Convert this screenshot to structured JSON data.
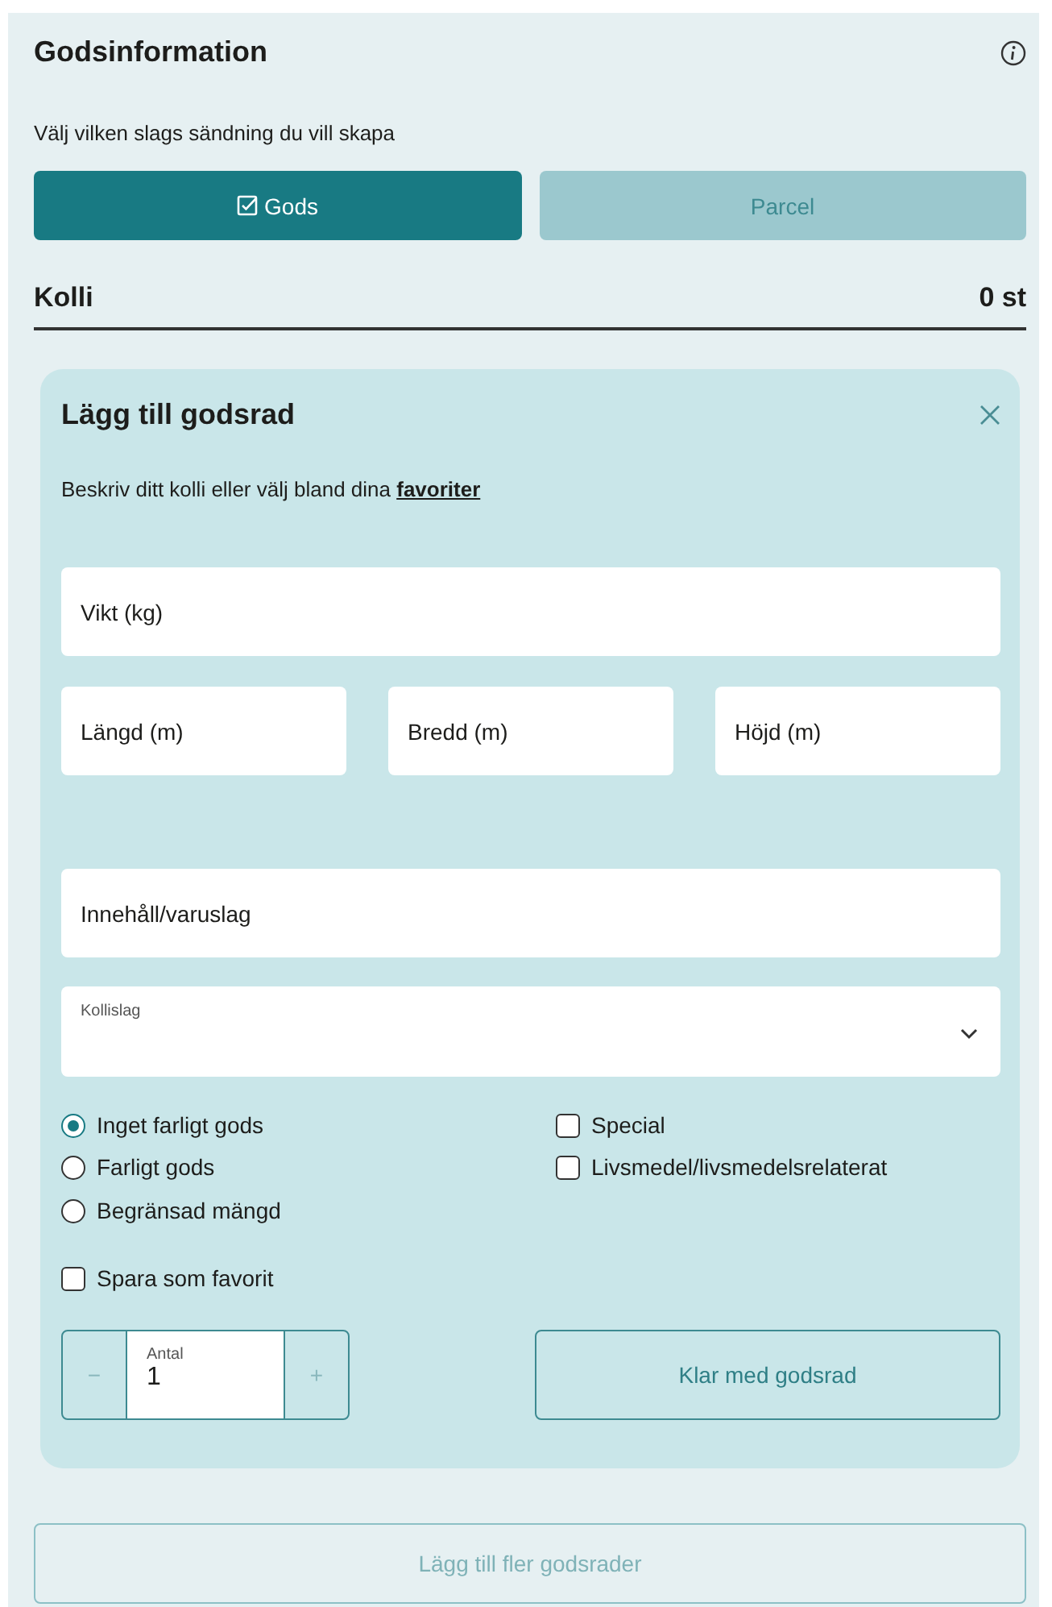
{
  "header": {
    "title": "Godsinformation",
    "subtitle": "Välj vilken slags sändning du vill skapa"
  },
  "tabs": [
    {
      "label": "Gods",
      "selected": true
    },
    {
      "label": "Parcel",
      "selected": false
    }
  ],
  "summary": {
    "label": "Kolli",
    "count": "0 st"
  },
  "card": {
    "title": "Lägg till godsrad",
    "description": "Beskriv ditt kolli eller välj bland dina",
    "link": "favoriter",
    "weight_field": {
      "placeholder": "Vikt (kg)"
    },
    "dimension_fields": [
      {
        "placeholder": "Längd (m)"
      },
      {
        "placeholder": "Bredd (m)"
      },
      {
        "placeholder": "Höjd (m)"
      }
    ],
    "content_field": {
      "placeholder": "Innehåll/varuslag"
    },
    "package_select": {
      "label": "Kollislag"
    },
    "hazard_options": [
      {
        "label": "Inget farligt gods",
        "selected": true
      },
      {
        "label": "Farligt gods",
        "selected": false
      },
      {
        "label": "Begränsad mängd",
        "selected": false
      }
    ],
    "extra_options": [
      {
        "label": "Special",
        "checked": false
      },
      {
        "label": "Livsmedel/livsmedelsrelaterat",
        "checked": false
      }
    ],
    "favorite_option": {
      "label": "Spara som favorit",
      "checked": false
    },
    "quantity": {
      "label": "Antal",
      "value": "1",
      "minus": "−",
      "plus": "+"
    },
    "done_button": "Klar med godsrad"
  },
  "add_more_button": "Lägg till fler godsrader"
}
